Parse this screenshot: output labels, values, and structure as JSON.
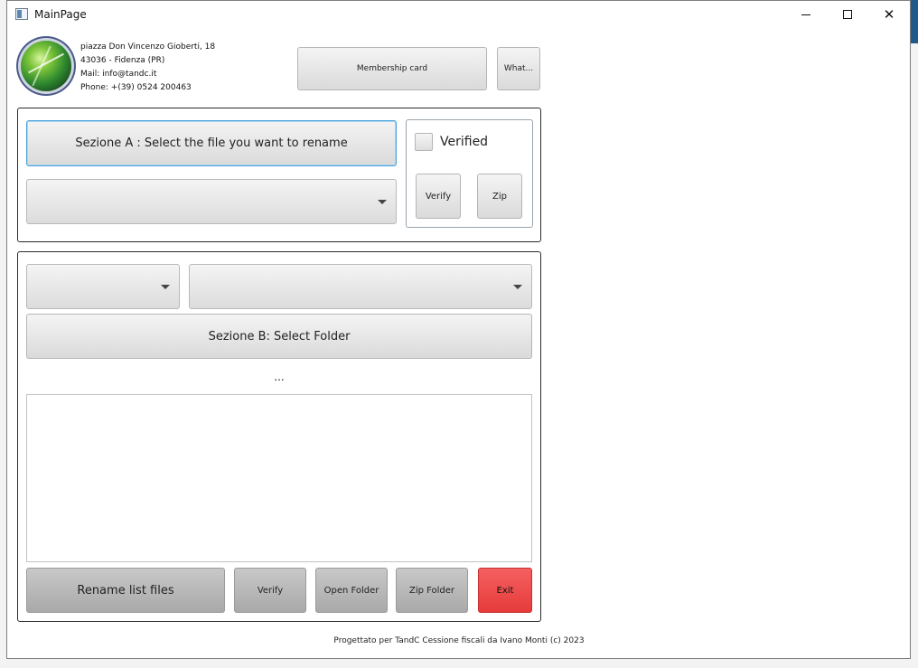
{
  "window": {
    "title": "MainPage"
  },
  "company": {
    "address_line1": "piazza Don Vincenzo Gioberti, 18",
    "address_line2": "43036 - Fidenza (PR)",
    "mail": "Mail: info@tandc.it",
    "phone": "Phone: +(39) 0524 200463"
  },
  "header_buttons": {
    "membership_card": "Membership card",
    "what": "What..."
  },
  "section_a": {
    "select_file_button": "Sezione A : Select the file you want to rename",
    "file_combo_value": "",
    "verified_label": "Verified",
    "verified_checked": false,
    "verify_button": "Verify",
    "zip_button": "Zip"
  },
  "section_b": {
    "combo1_value": "",
    "combo2_value": "",
    "select_folder_button": "Sezione B: Select Folder",
    "folder_path": "...",
    "files_list": [],
    "rename_button": "Rename list files",
    "verify_button": "Verify",
    "open_folder_button": "Open Folder",
    "zip_folder_button": "Zip Folder",
    "exit_button": "Exit",
    "exit_color": "#e84545"
  },
  "footer": {
    "credit": "Progettato per TandC Cessione fiscali da Ivano Monti (c) 2023"
  }
}
